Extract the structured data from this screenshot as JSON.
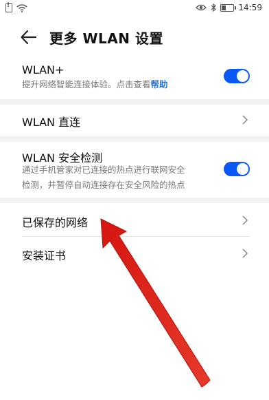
{
  "status_bar": {
    "time": "14:59",
    "icons": [
      "sim-alert-icon",
      "wifi-icon",
      "eye-icon",
      "bluetooth-icon",
      "battery-icon"
    ]
  },
  "header": {
    "title": "更多 WLAN 设置",
    "back_icon": "arrow-left-icon"
  },
  "settings": {
    "wlan_plus": {
      "title": "WLAN+",
      "description": "提升网络智能连接体验。点击查看",
      "help_link": "帮助",
      "enabled": true
    },
    "wlan_direct": {
      "title": "WLAN 直连"
    },
    "wlan_security": {
      "title": "WLAN 安全检测",
      "description_line1": "通过手机管家对已连接的热点进行联网安全",
      "description_line2": "检测，并暂停自动连接存在安全风险的热点",
      "enabled": true
    },
    "saved_networks": {
      "title": "已保存的网络"
    },
    "install_cert": {
      "title": "安装证书"
    }
  },
  "colors": {
    "accent": "#0a59f7",
    "link": "#1a73e8",
    "annotation_arrow": "#e0201b",
    "section_gap": "#f2f2f2"
  }
}
